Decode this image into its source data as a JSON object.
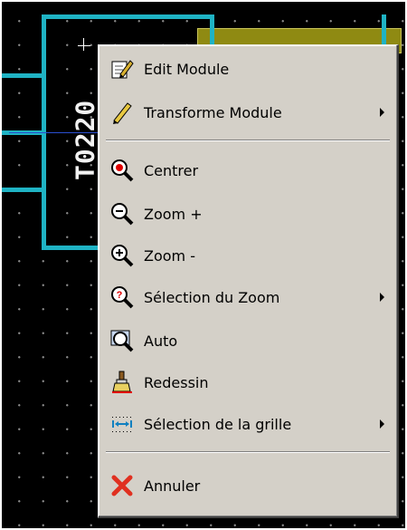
{
  "canvas": {
    "component_reference": "T0220",
    "track_color": "#1fb3c4",
    "pad_color": "#8f8a12",
    "background_color": "#000000"
  },
  "context_menu": {
    "items": [
      {
        "label": "Edit Module",
        "icon": "edit-module-icon",
        "submenu": false
      },
      {
        "label": "Transforme Module",
        "icon": "pencil-icon",
        "submenu": true
      },
      {
        "label": "Centrer",
        "icon": "center-zoom-icon",
        "submenu": false
      },
      {
        "label": "Zoom +",
        "icon": "zoom-in-icon",
        "submenu": false
      },
      {
        "label": "Zoom -",
        "icon": "zoom-out-icon",
        "submenu": false
      },
      {
        "label": "Sélection du Zoom",
        "icon": "zoom-select-icon",
        "submenu": true
      },
      {
        "label": "Auto",
        "icon": "zoom-auto-icon",
        "submenu": false
      },
      {
        "label": "Redessin",
        "icon": "redraw-brush-icon",
        "submenu": false
      },
      {
        "label": "Sélection de la grille",
        "icon": "grid-select-icon",
        "submenu": true
      },
      {
        "label": "Annuler",
        "icon": "cancel-x-icon",
        "submenu": false
      }
    ]
  }
}
